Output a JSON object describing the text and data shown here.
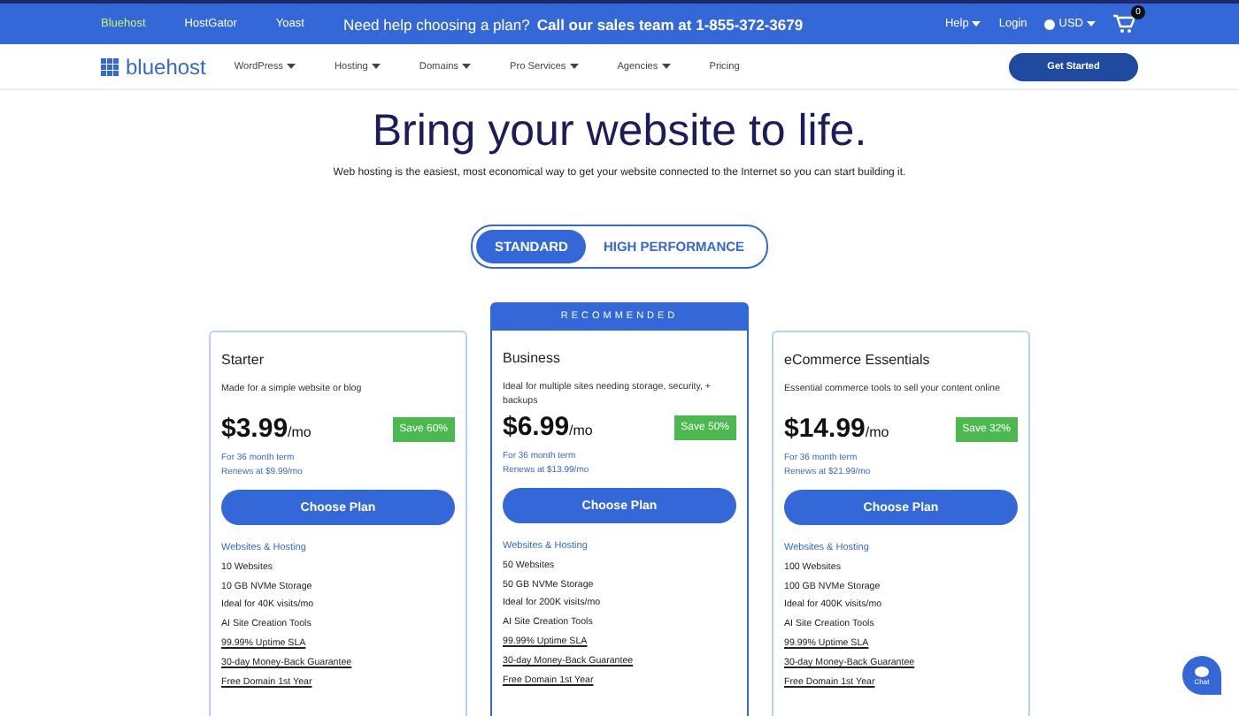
{
  "top_bar": {
    "brands": [
      {
        "label": "Bluehost",
        "selected": true
      },
      {
        "label": "HostGator",
        "selected": false
      },
      {
        "label": "Yoast",
        "selected": false
      }
    ],
    "promo": "Need help choosing a plan?",
    "promo_bold": "Call our sales team at 1-855-372-3679",
    "help": "Help",
    "login": "Login",
    "currency": "USD",
    "cart_count": "0"
  },
  "nav": {
    "logo": "bluehost",
    "items": [
      {
        "label": "WordPress",
        "dropdown": true
      },
      {
        "label": "Hosting",
        "dropdown": true
      },
      {
        "label": "Domains",
        "dropdown": true
      },
      {
        "label": "Pro Services",
        "dropdown": true
      },
      {
        "label": "Agencies",
        "dropdown": true
      },
      {
        "label": "Pricing",
        "dropdown": false
      }
    ],
    "cta": "Get Started"
  },
  "hero": {
    "title": "Bring your website to life.",
    "subtitle": "Web hosting is the easiest, most economical way to get your website connected to the Internet so you can start building it."
  },
  "toggle": [
    {
      "label": "STANDARD",
      "selected": true
    },
    {
      "label": "HIGH PERFORMANCE",
      "selected": false
    }
  ],
  "plans": [
    {
      "name": "Starter",
      "recommended": false,
      "description": "Made for a simple website or blog",
      "price": "$3.99",
      "unit": "/mo",
      "save": "Save 60%",
      "term": "For 36 month term",
      "renews": "Renews at $9.99/mo",
      "button": "Choose Plan",
      "category": "Websites & Hosting",
      "features": [
        {
          "text": "10 Websites",
          "kind": "plain"
        },
        {
          "text": "10 GB NVMe Storage",
          "kind": "plain"
        },
        {
          "text": "Ideal for 40K visits/mo",
          "kind": "plain"
        },
        {
          "text": "AI Site Creation Tools",
          "kind": "plain"
        },
        {
          "text": "99.99% Uptime SLA",
          "kind": "link"
        },
        {
          "text": "30-day Money-Back Guarantee",
          "kind": "link"
        },
        {
          "text": "Free Domain 1st Year",
          "kind": "link"
        }
      ]
    },
    {
      "name": "Business",
      "recommended": true,
      "badge": "RECOMMENDED",
      "description": "Ideal for multiple sites needing storage, security, + backups",
      "price": "$6.99",
      "unit": "/mo",
      "save": "Save 50%",
      "term": "For 36 month term",
      "renews": "Renews at $13.99/mo",
      "button": "Choose Plan",
      "category": "Websites & Hosting",
      "features": [
        {
          "text": "50 Websites",
          "kind": "plain"
        },
        {
          "text": "50 GB NVMe Storage",
          "kind": "plain"
        },
        {
          "text": "Ideal for 200K visits/mo",
          "kind": "plain"
        },
        {
          "text": "AI Site Creation Tools",
          "kind": "plain"
        },
        {
          "text": "99.99% Uptime SLA",
          "kind": "link"
        },
        {
          "text": "30-day Money-Back Guarantee",
          "kind": "link"
        },
        {
          "text": "Free Domain 1st Year",
          "kind": "link"
        }
      ]
    },
    {
      "name": "eCommerce Essentials",
      "recommended": false,
      "description": "Essential commerce tools to sell your content online",
      "price": "$14.99",
      "unit": "/mo",
      "save": "Save 32%",
      "term": "For 36 month term",
      "renews": "Renews at $21.99/mo",
      "button": "Choose Plan",
      "category": "Websites & Hosting",
      "features": [
        {
          "text": "100 Websites",
          "kind": "plain"
        },
        {
          "text": "100 GB NVMe Storage",
          "kind": "plain"
        },
        {
          "text": "Ideal for 400K visits/mo",
          "kind": "plain"
        },
        {
          "text": "AI Site Creation Tools",
          "kind": "plain"
        },
        {
          "text": "99.99% Uptime SLA",
          "kind": "link"
        },
        {
          "text": "30-day Money-Back Guarantee",
          "kind": "link"
        },
        {
          "text": "Free Domain 1st Year",
          "kind": "link"
        }
      ]
    }
  ],
  "chat": {
    "label": "Chat"
  }
}
